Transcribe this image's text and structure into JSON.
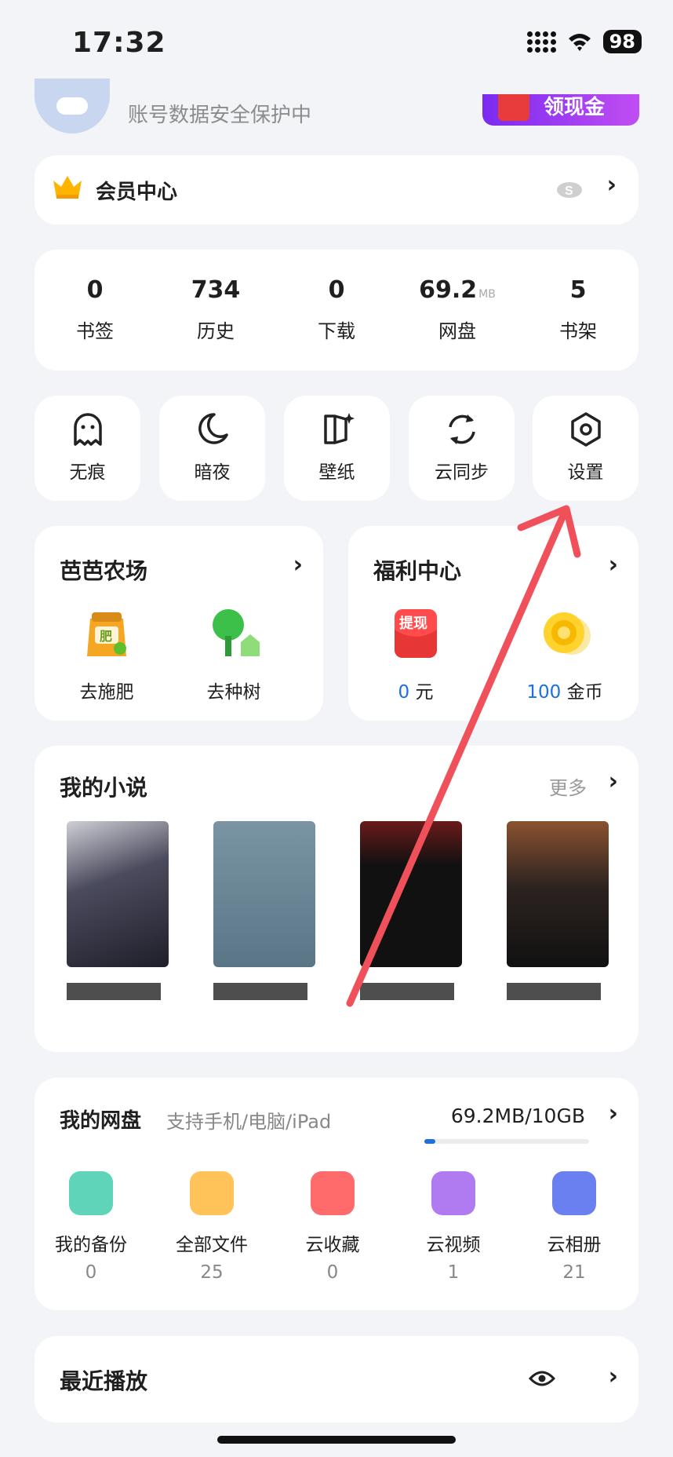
{
  "status_bar": {
    "time": "17:32",
    "battery": "98"
  },
  "header": {
    "account_status": "账号数据安全保护中",
    "banner": "领现金"
  },
  "member": {
    "label": "会员中心"
  },
  "stats": [
    {
      "value": "0",
      "unit": "",
      "label": "书签"
    },
    {
      "value": "734",
      "unit": "",
      "label": "历史"
    },
    {
      "value": "0",
      "unit": "",
      "label": "下载"
    },
    {
      "value": "69.2",
      "unit": "MB",
      "label": "网盘"
    },
    {
      "value": "5",
      "unit": "",
      "label": "书架"
    }
  ],
  "tools": [
    {
      "label": "无痕",
      "icon": "ghost-icon"
    },
    {
      "label": "暗夜",
      "icon": "moon-icon"
    },
    {
      "label": "壁纸",
      "icon": "wallpaper-icon"
    },
    {
      "label": "云同步",
      "icon": "sync-icon"
    },
    {
      "label": "设置",
      "icon": "settings-icon"
    }
  ],
  "farm": {
    "title": "芭芭农场",
    "actions": [
      "去施肥",
      "去种树"
    ],
    "fertilizer_tag": "肥"
  },
  "welfare": {
    "title": "福利中心",
    "cash_tag": "提现",
    "cash_value": "0",
    "cash_unit": "元",
    "coin_value": "100",
    "coin_unit": "金币"
  },
  "novels": {
    "title": "我的小说",
    "more": "更多",
    "count": 4
  },
  "cloud": {
    "title": "我的网盘",
    "subtitle": "支持手机/电脑/iPad",
    "usage": "69.2MB/10GB",
    "usage_fraction": 0.0068,
    "items": [
      {
        "label": "我的备份",
        "count": "0",
        "color": "#5fd4b8"
      },
      {
        "label": "全部文件",
        "count": "25",
        "color": "#ffc35a"
      },
      {
        "label": "云收藏",
        "count": "0",
        "color": "#ff6b6b"
      },
      {
        "label": "云视频",
        "count": "1",
        "color": "#b07af0"
      },
      {
        "label": "云相册",
        "count": "21",
        "color": "#6a7ff0"
      }
    ]
  },
  "recent": {
    "title": "最近播放"
  },
  "colors": {
    "annotation_arrow": "#f0505a",
    "accent_blue": "#1b6fe0"
  }
}
